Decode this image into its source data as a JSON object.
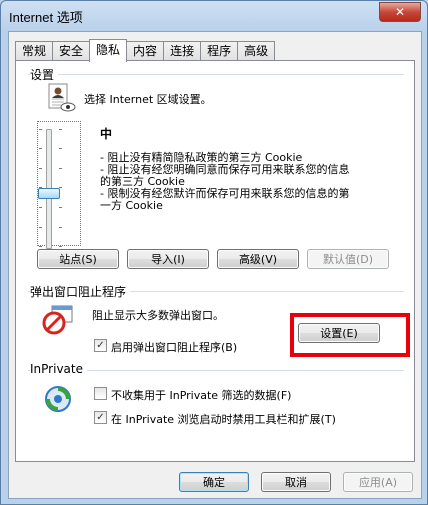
{
  "window": {
    "title": "Internet 选项",
    "close_label": "✕"
  },
  "tabs": [
    {
      "label": "常规"
    },
    {
      "label": "安全"
    },
    {
      "label": "隐私"
    },
    {
      "label": "内容"
    },
    {
      "label": "连接"
    },
    {
      "label": "程序"
    },
    {
      "label": "高级"
    }
  ],
  "settings": {
    "group_label": "设置",
    "zone_text": "选择 Internet 区域设置。",
    "level_title": "中",
    "bullet_1_line_1": "- 阻止没有精简隐私政策的第三方 Cookie",
    "bullet_2_line_1": "- 阻止没有经您明确同意而保存可用来联系您的信息",
    "bullet_2_line_2": "的第三方 Cookie",
    "bullet_3_line_1": "- 限制没有经您默许而保存可用来联系您的信息的第",
    "bullet_3_line_2": "一方 Cookie",
    "slider_level": 0.5,
    "buttons": {
      "sites": "站点(S)",
      "import": "导入(I)",
      "advanced": "高级(V)",
      "default": "默认值(D)"
    }
  },
  "popup": {
    "group_label": "弹出窗口阻止程序",
    "description": "阻止显示大多数弹出窗口。",
    "settings_button": "设置(E)",
    "enable_checkbox_label": "启用弹出窗口阻止程序(B)",
    "enable_checked": true
  },
  "inprivate": {
    "group_label": "InPrivate",
    "no_collect_label": "不收集用于 InPrivate 筛选的数据(F)",
    "no_collect_checked": false,
    "disable_toolbars_label": "在 InPrivate 浏览启动时禁用工具栏和扩展(T)",
    "disable_toolbars_checked": true
  },
  "footer": {
    "ok": "确定",
    "cancel": "取消",
    "apply": "应用(A)"
  },
  "colors": {
    "highlight_box": "#e8000d",
    "title_bar": "#b9d1ea",
    "close_button": "#c5483a"
  },
  "icons": {
    "privacy": "privacy-doc-user-icon",
    "popup": "popup-blocked-icon",
    "inprivate": "inprivate-refresh-icon",
    "checkmark": "✓"
  }
}
